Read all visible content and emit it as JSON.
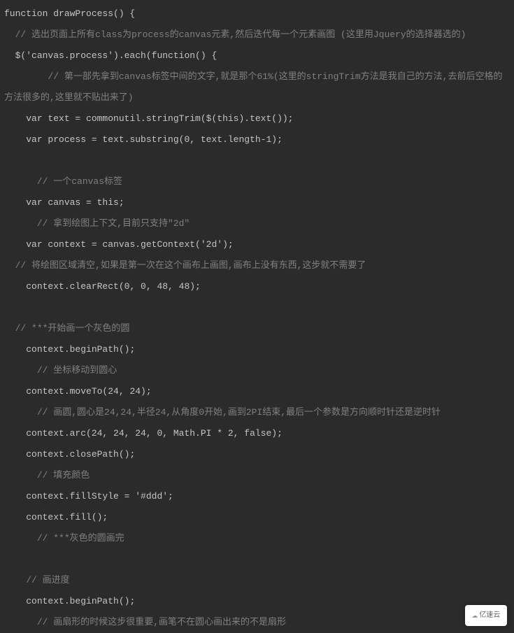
{
  "code": {
    "lines": [
      {
        "content": "function drawProcess() {",
        "indent": 0
      },
      {
        "content": "// 选出页面上所有class为process的canvas元素,然后迭代每一个元素画图 (这里用Jquery的选择器选的)",
        "indent": 1,
        "type": "comment"
      },
      {
        "content": "$('canvas.process').each(function() {",
        "indent": 1
      },
      {
        "content": "// 第一部先拿到canvas标签中间的文字,就是那个61%(这里的stringTrim方法是我自己的方法,去前后空格的方法很多的,这里就不贴出来了)",
        "indent": 4,
        "type": "comment",
        "wrap": true,
        "wrapIndent": 0
      },
      {
        "content": "var text = commonutil.stringTrim($(this).text());",
        "indent": 2
      },
      {
        "content": "var process = text.substring(0, text.length-1);",
        "indent": 2
      },
      {
        "content": "",
        "indent": 0,
        "blank": true
      },
      {
        "content": "// 一个canvas标签",
        "indent": 3,
        "type": "comment"
      },
      {
        "content": "var canvas = this;",
        "indent": 2
      },
      {
        "content": "// 拿到绘图上下文,目前只支持\"2d\"",
        "indent": 3,
        "type": "comment"
      },
      {
        "content": "var context = canvas.getContext('2d');",
        "indent": 2
      },
      {
        "content": "// 将绘图区域清空,如果是第一次在这个画布上画图,画布上没有东西,这步就不需要了",
        "indent": 1,
        "type": "comment"
      },
      {
        "content": "context.clearRect(0, 0, 48, 48);",
        "indent": 2
      },
      {
        "content": "",
        "indent": 0,
        "blank": true
      },
      {
        "content": "// ***开始画一个灰色的圆",
        "indent": 1,
        "type": "comment"
      },
      {
        "content": "context.beginPath();",
        "indent": 2
      },
      {
        "content": "// 坐标移动到圆心",
        "indent": 3,
        "type": "comment"
      },
      {
        "content": "context.moveTo(24, 24);",
        "indent": 2
      },
      {
        "content": "// 画圆,圆心是24,24,半径24,从角度0开始,画到2PI结束,最后一个参数是方向顺时针还是逆时针",
        "indent": 3,
        "type": "comment"
      },
      {
        "content": "context.arc(24, 24, 24, 0, Math.PI * 2, false);",
        "indent": 2
      },
      {
        "content": "context.closePath();",
        "indent": 2
      },
      {
        "content": "// 填充颜色",
        "indent": 3,
        "type": "comment"
      },
      {
        "content": "context.fillStyle = '#ddd';",
        "indent": 2
      },
      {
        "content": "context.fill();",
        "indent": 2
      },
      {
        "content": "// ***灰色的圆画完",
        "indent": 3,
        "type": "comment"
      },
      {
        "content": "",
        "indent": 0,
        "blank": true
      },
      {
        "content": "// 画进度",
        "indent": 2,
        "type": "comment"
      },
      {
        "content": "context.beginPath();",
        "indent": 2
      },
      {
        "content": "// 画扇形的时候这步很重要,画笔不在圆心画出来的不是扇形",
        "indent": 3,
        "type": "comment"
      }
    ]
  },
  "logo": {
    "text": "亿速云"
  }
}
